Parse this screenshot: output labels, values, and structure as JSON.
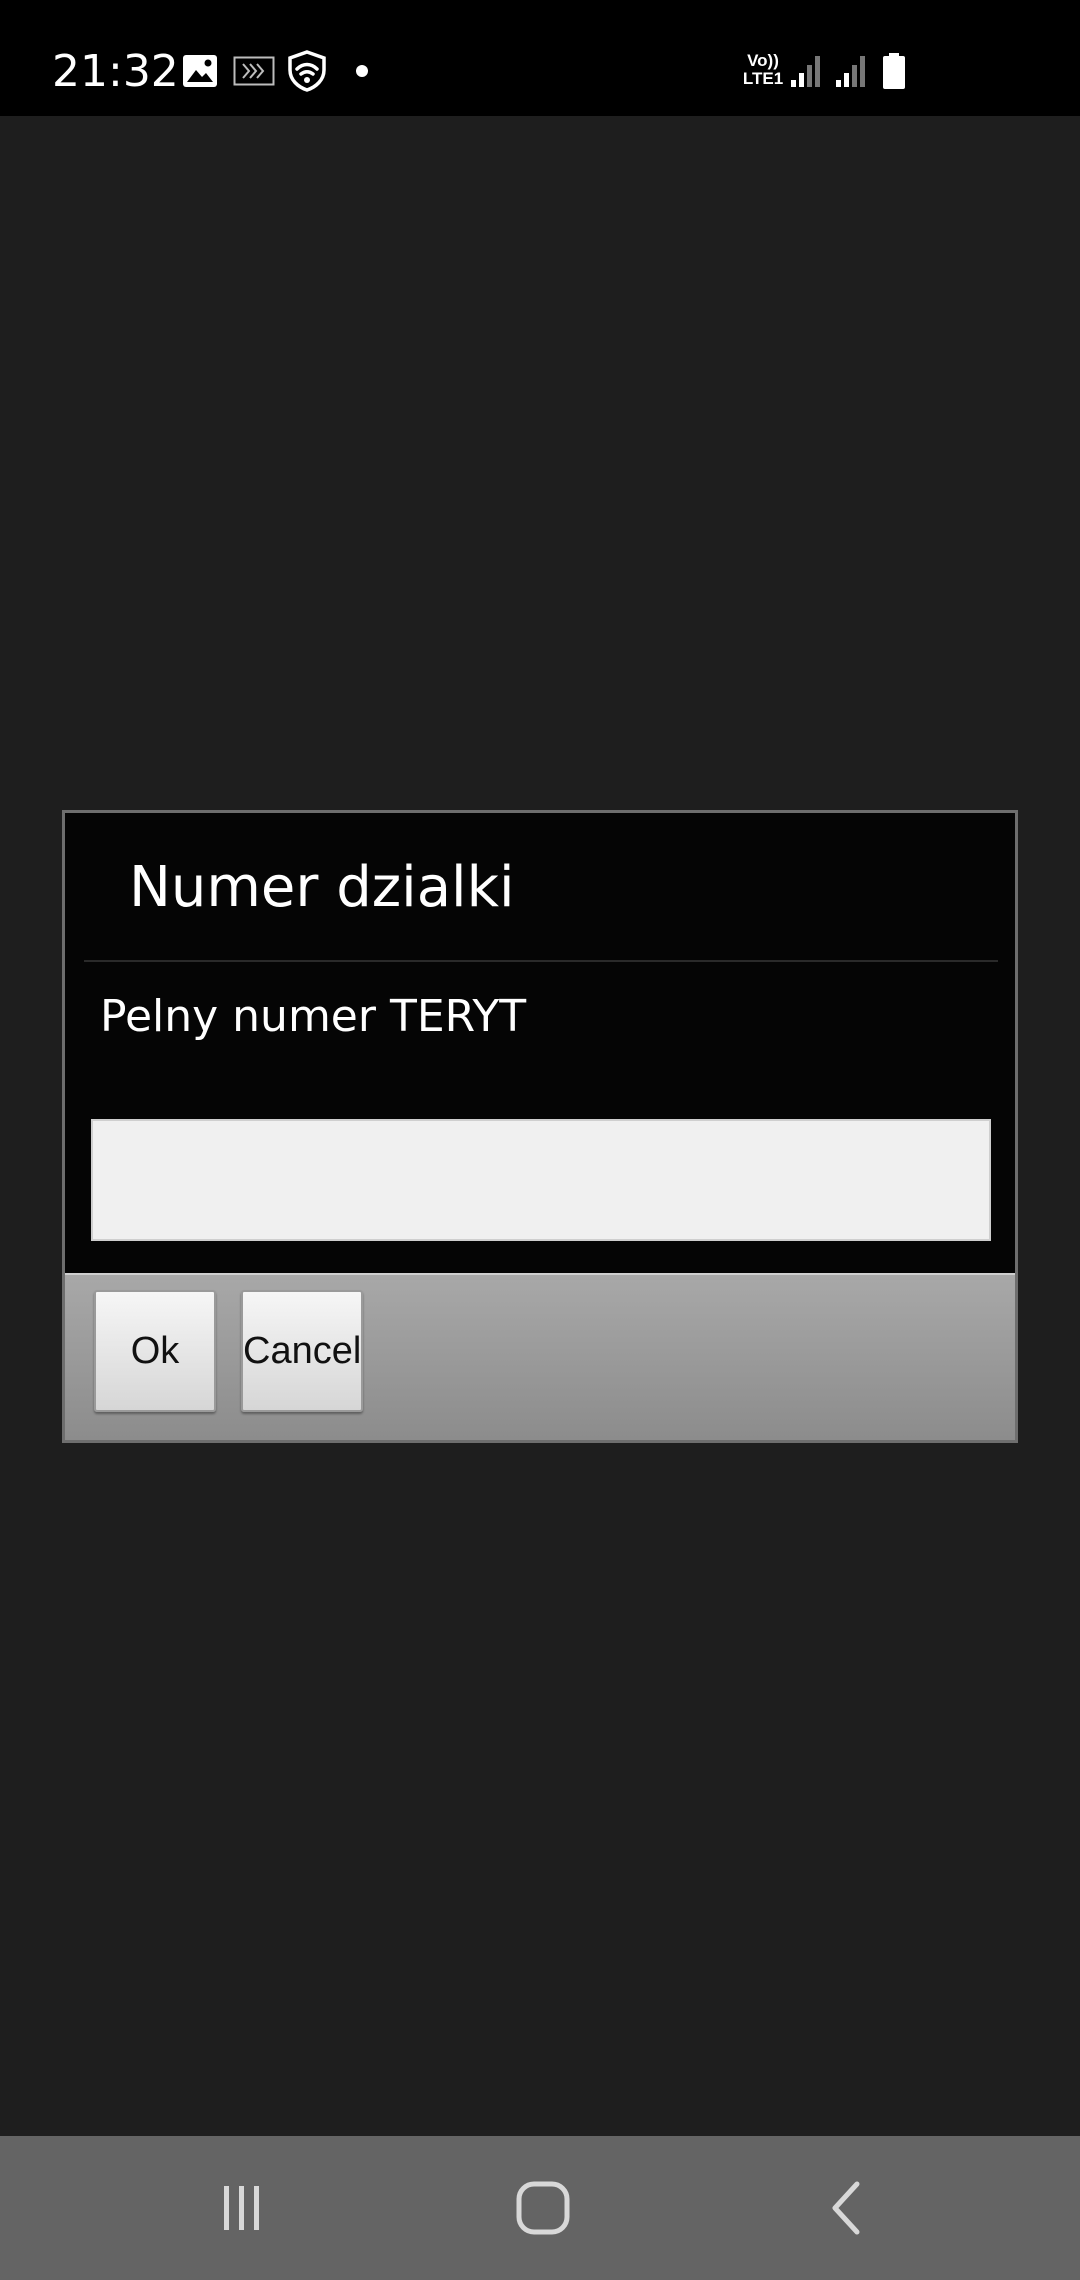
{
  "status_bar": {
    "time": "21:32",
    "network_label_top": "Vo))",
    "network_label_bottom": "LTE1",
    "icons": [
      "gallery-icon",
      "cast-icon",
      "vpn-shield-icon",
      "notification-dot-icon",
      "volte-lte-icon",
      "signal-sim1-icon",
      "signal-sim2-icon",
      "battery-icon"
    ]
  },
  "dialog": {
    "title": "Numer dzialki",
    "message": "Pelny numer TERYT",
    "input_value": "",
    "input_placeholder": "",
    "ok_label": "Ok",
    "cancel_label": "Cancel"
  },
  "navbar": {
    "icons": [
      "recent-apps-icon",
      "home-icon",
      "back-icon"
    ]
  },
  "colors": {
    "background": "#1e1e1e",
    "dialog_background": "#050505",
    "status_bar": "#000000",
    "navbar": "#646464",
    "input_background": "#f0f0f0"
  }
}
